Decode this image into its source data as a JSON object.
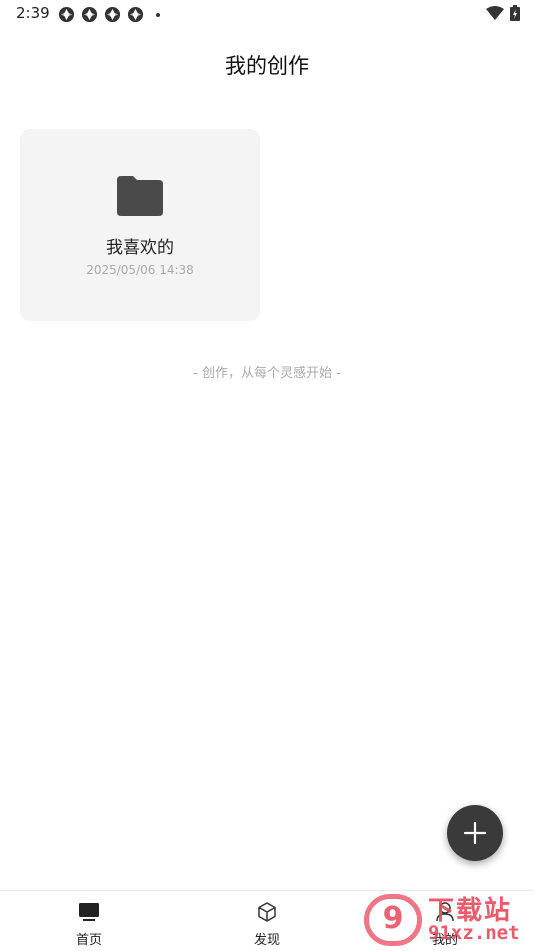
{
  "status_bar": {
    "time": "2:39",
    "notification_icons": [
      "app-icon",
      "app-icon",
      "app-icon",
      "app-icon"
    ],
    "wifi_icon": "wifi-icon",
    "battery_icon": "battery-icon"
  },
  "header": {
    "title": "我的创作"
  },
  "folders": [
    {
      "name": "我喜欢的",
      "date": "2025/05/06 14:38",
      "icon": "folder-icon"
    }
  ],
  "hint_text": "- 创作，从每个灵感开始 -",
  "fab": {
    "icon": "plus-icon"
  },
  "bottom_nav": {
    "items": [
      {
        "label": "首页",
        "icon": "monitor-icon",
        "active": true
      },
      {
        "label": "发现",
        "icon": "cube-icon",
        "active": false
      },
      {
        "label": "我的",
        "icon": "user-icon",
        "active": false
      }
    ]
  },
  "watermark": {
    "badge": "9",
    "top_text": "下载站",
    "bottom_text": "91xz.net"
  },
  "colors": {
    "card_bg": "#f4f4f4",
    "fab_bg": "#3a3a3a",
    "folder": "#4a4a4a",
    "watermark": "#e9495c"
  }
}
